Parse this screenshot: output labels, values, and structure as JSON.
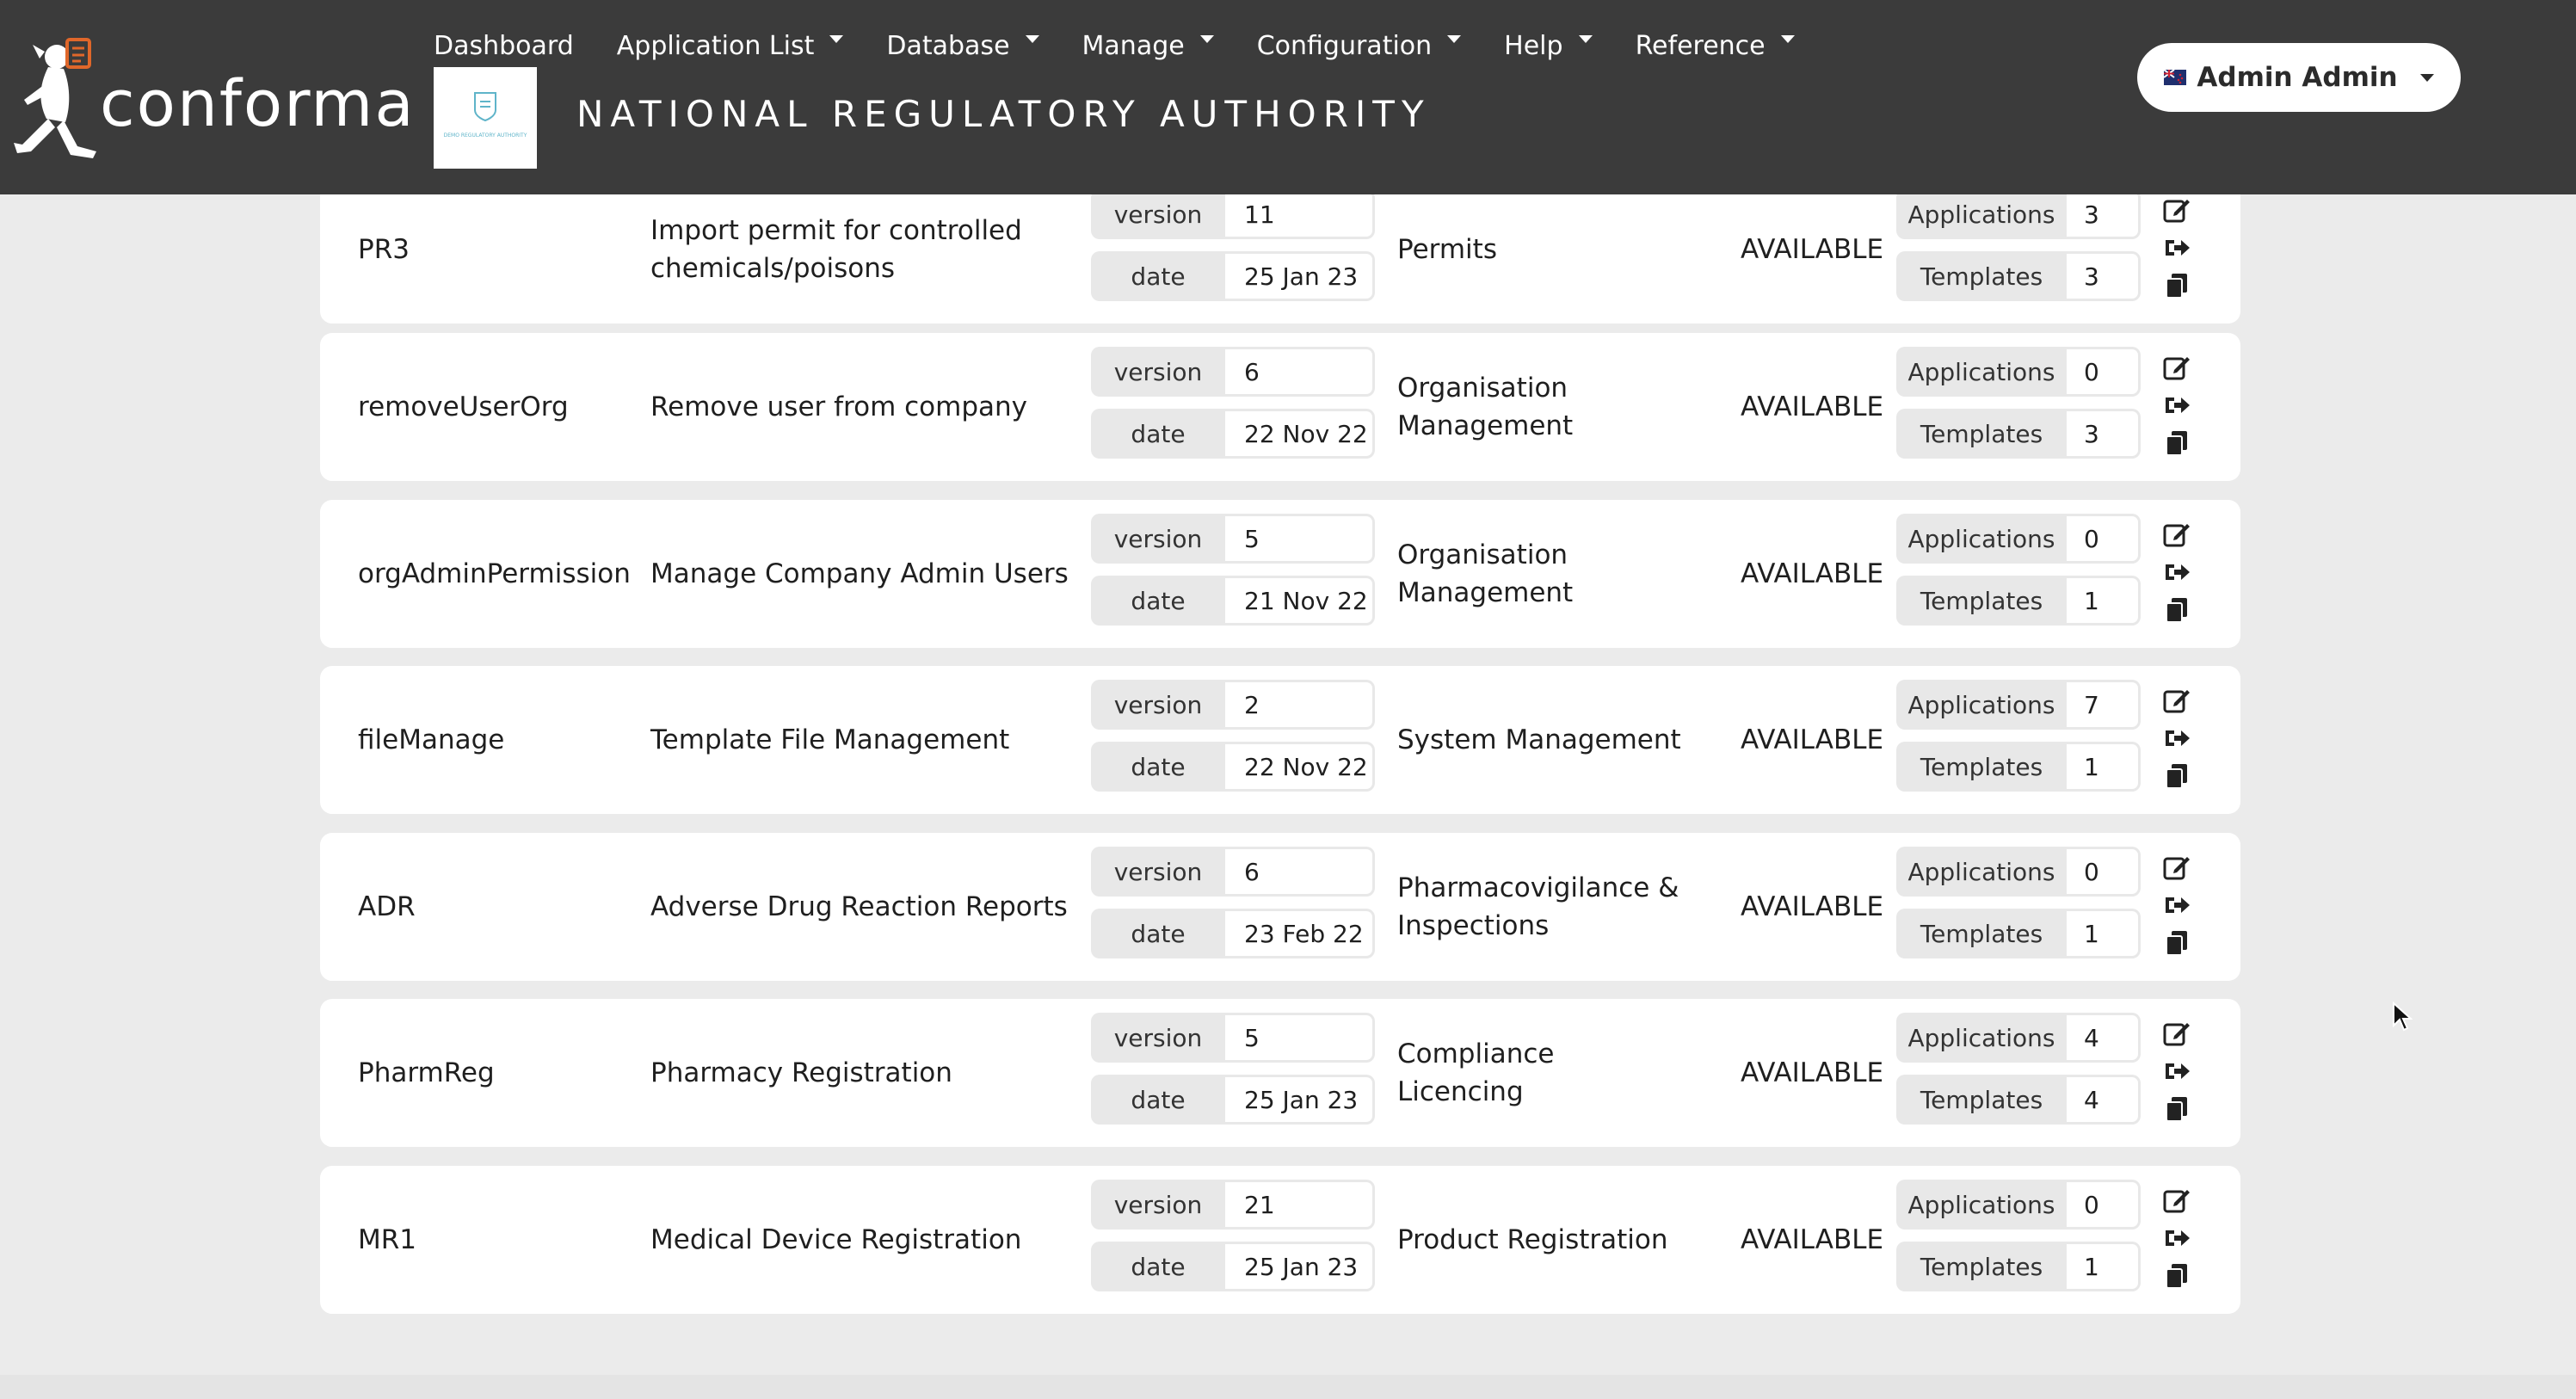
{
  "header": {
    "brand": "conforma",
    "org_title": "NATIONAL REGULATORY AUTHORITY",
    "org_logo_text": "DEMO REGULATORY AUTHORITY",
    "nav": [
      {
        "label": "Dashboard",
        "dropdown": false
      },
      {
        "label": "Application List",
        "dropdown": true
      },
      {
        "label": "Database",
        "dropdown": true
      },
      {
        "label": "Manage",
        "dropdown": true
      },
      {
        "label": "Configuration",
        "dropdown": true
      },
      {
        "label": "Help",
        "dropdown": true
      },
      {
        "label": "Reference",
        "dropdown": true
      }
    ],
    "user": {
      "name": "Admin Admin",
      "flag_icon": "new-zealand-flag-icon"
    }
  },
  "labels": {
    "version": "version",
    "date": "date",
    "applications": "Applications",
    "templates": "Templates"
  },
  "templates": [
    {
      "code": "PR3",
      "name": "Import permit for controlled chemicals/poisons",
      "version": "11",
      "date": "25 Jan 23",
      "category": "Permits",
      "status": "AVAILABLE",
      "applications": "3",
      "templates": "3"
    },
    {
      "code": "removeUserOrg",
      "name": "Remove user from company",
      "version": "6",
      "date": "22 Nov 22",
      "category": "Organisation Management",
      "status": "AVAILABLE",
      "applications": "0",
      "templates": "3"
    },
    {
      "code": "orgAdminPermission",
      "name": "Manage Company Admin Users",
      "version": "5",
      "date": "21 Nov 22",
      "category": "Organisation Management",
      "status": "AVAILABLE",
      "applications": "0",
      "templates": "1"
    },
    {
      "code": "fileManage",
      "name": "Template File Management",
      "version": "2",
      "date": "22 Nov 22",
      "category": "System Management",
      "status": "AVAILABLE",
      "applications": "7",
      "templates": "1"
    },
    {
      "code": "ADR",
      "name": "Adverse Drug Reaction Reports",
      "version": "6",
      "date": "23 Feb 22",
      "category": "Pharmacovigilance & Inspections",
      "status": "AVAILABLE",
      "applications": "0",
      "templates": "1"
    },
    {
      "code": "PharmReg",
      "name": "Pharmacy Registration",
      "version": "5",
      "date": "25 Jan 23",
      "category": "Compliance Licencing",
      "status": "AVAILABLE",
      "applications": "4",
      "templates": "4"
    },
    {
      "code": "MR1",
      "name": "Medical Device Registration",
      "version": "21",
      "date": "25 Jan 23",
      "category": "Product Registration",
      "status": "AVAILABLE",
      "applications": "0",
      "templates": "1"
    }
  ],
  "icons": {
    "edit": "edit-icon",
    "export": "export-icon",
    "copy": "copy-icon"
  },
  "colors": {
    "header_bg": "#3b3b3b",
    "page_bg": "#ebebeb",
    "row_bg": "#ffffff",
    "label_bg": "#e8e8e8",
    "logo_accent": "#e0672a"
  }
}
